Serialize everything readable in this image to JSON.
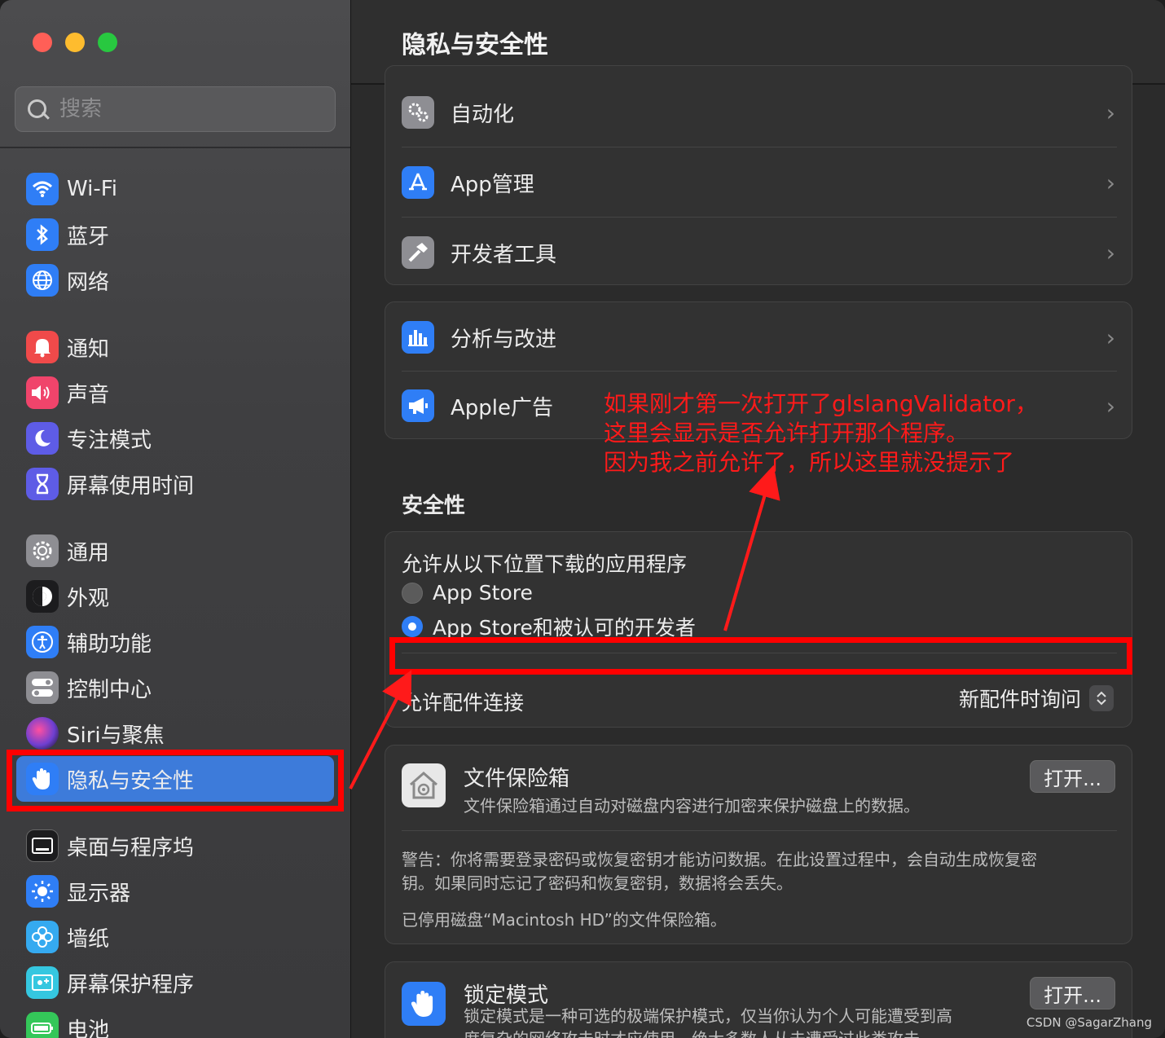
{
  "window": {
    "traffic_lights": [
      "#ff5f57",
      "#febc2e",
      "#28c840"
    ]
  },
  "search": {
    "placeholder": "搜索"
  },
  "sidebar": {
    "items": [
      {
        "label": "Wi-Fi",
        "icon": "wifi-icon",
        "color": "#2f7ef6"
      },
      {
        "label": "蓝牙",
        "icon": "bluetooth-icon",
        "color": "#2f7ef6"
      },
      {
        "label": "网络",
        "icon": "globe-icon",
        "color": "#2f7ef6"
      },
      {
        "label": "通知",
        "icon": "bell-icon",
        "color": "#f04a4a"
      },
      {
        "label": "声音",
        "icon": "speaker-icon",
        "color": "#f0446b"
      },
      {
        "label": "专注模式",
        "icon": "moon-icon",
        "color": "#5e5ce6"
      },
      {
        "label": "屏幕使用时间",
        "icon": "hourglass-icon",
        "color": "#5e5ce6"
      },
      {
        "label": "通用",
        "icon": "gear-icon",
        "color": "#8e8e93"
      },
      {
        "label": "外观",
        "icon": "appearance-icon",
        "color": "#1c1c1e"
      },
      {
        "label": "辅助功能",
        "icon": "accessibility-icon",
        "color": "#2f7ef6"
      },
      {
        "label": "控制中心",
        "icon": "toggles-icon",
        "color": "#8e8e93"
      },
      {
        "label": "Siri与聚焦",
        "icon": "siri-icon",
        "color": "#6e3fd1"
      },
      {
        "label": "隐私与安全性",
        "icon": "hand-icon",
        "color": "#2f7ef6"
      },
      {
        "label": "桌面与程序坞",
        "icon": "dock-icon",
        "color": "#1c1c1e"
      },
      {
        "label": "显示器",
        "icon": "sun-icon",
        "color": "#2f7ef6"
      },
      {
        "label": "墙纸",
        "icon": "flower-icon",
        "color": "#35aaf0"
      },
      {
        "label": "屏幕保护程序",
        "icon": "screensaver-icon",
        "color": "#35c7e0"
      },
      {
        "label": "电池",
        "icon": "battery-icon",
        "color": "#34c759"
      }
    ],
    "selected": "隐私与安全性"
  },
  "main": {
    "title": "隐私与安全性",
    "group1": [
      {
        "label": "自动化",
        "icon": "gears-icon"
      },
      {
        "label": "App管理",
        "icon": "appstore-icon"
      },
      {
        "label": "开发者工具",
        "icon": "hammer-icon"
      }
    ],
    "group2": [
      {
        "label": "分析与改进",
        "icon": "chart-icon"
      },
      {
        "label": "Apple广告",
        "icon": "megaphone-icon"
      }
    ],
    "chevron": "›",
    "security": {
      "title": "安全性",
      "allow_title": "允许从以下位置下载的应用程序",
      "option1": "App Store",
      "option2": "App Store和被认可的开发者",
      "selected_option": "App Store和被认可的开发者",
      "accessory_label": "允许配件连接",
      "accessory_value": "新配件时询问"
    },
    "filevault": {
      "title": "文件保险箱",
      "desc": "文件保险箱通过自动对磁盘内容进行加密来保护磁盘上的数据。",
      "button": "打开...",
      "warning_line1": "警告：你将需要登录密码或恢复密钥才能访问数据。在此设置过程中，会自动生成恢复密",
      "warning_line2": "钥。如果同时忘记了密码和恢复密钥，数据将会丢失。",
      "status": "已停用磁盘“Macintosh HD”的文件保险箱。"
    },
    "lockdown": {
      "title": "锁定模式",
      "desc_line1": "锁定模式是一种可选的极端保护模式，仅当你认为个人可能遭受到高",
      "desc_line2": "度复杂的网络攻击时才应使用。绝大多数人从未遭受过此类攻击。",
      "button": "打开..."
    }
  },
  "annotation": {
    "line1": "如果刚才第一次打开了glslangValidator，",
    "line2": "这里会显示是否允许打开那个程序。",
    "line3": "因为我之前允许了，所以这里就没提示了",
    "color": "#ff1a1a"
  },
  "watermark": "CSDN @SagarZhang"
}
